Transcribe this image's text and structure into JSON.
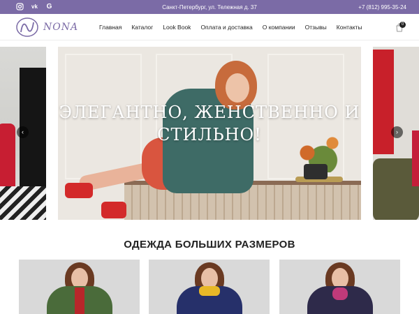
{
  "topbar": {
    "social": [
      {
        "icon": "instagram-icon",
        "glyph": "◎"
      },
      {
        "icon": "vk-icon",
        "glyph": "vk"
      },
      {
        "icon": "google-icon",
        "glyph": "G"
      }
    ],
    "address": "Санкт-Петербург, ул. Тележная д. 37",
    "phone": "+7 (812) 995-35-24"
  },
  "header": {
    "logo_text": "NONA",
    "nav": [
      "Главная",
      "Каталог",
      "Look Book",
      "Оплата и доставка",
      "О компании",
      "Отзывы",
      "Контакты"
    ],
    "cart_count": "0"
  },
  "slider": {
    "title": "ЭЛЕГАНТНО, ЖЕНСТВЕННО И СТИЛЬНО!",
    "prev_glyph": "‹",
    "next_glyph": "›"
  },
  "section": {
    "title": "ОДЕЖДА БОЛЬШИХ РАЗМЕРОВ"
  },
  "products": [
    {
      "jacket_color": "#4a6b3a",
      "accent": "#b7262a"
    },
    {
      "jacket_color": "#26306a",
      "accent": "#e8b828"
    },
    {
      "jacket_color": "#2e2a4a",
      "accent": "#c03a7a"
    }
  ],
  "colors": {
    "brand": "#7b6ba6",
    "topbar_bg": "#7b6ba6"
  }
}
